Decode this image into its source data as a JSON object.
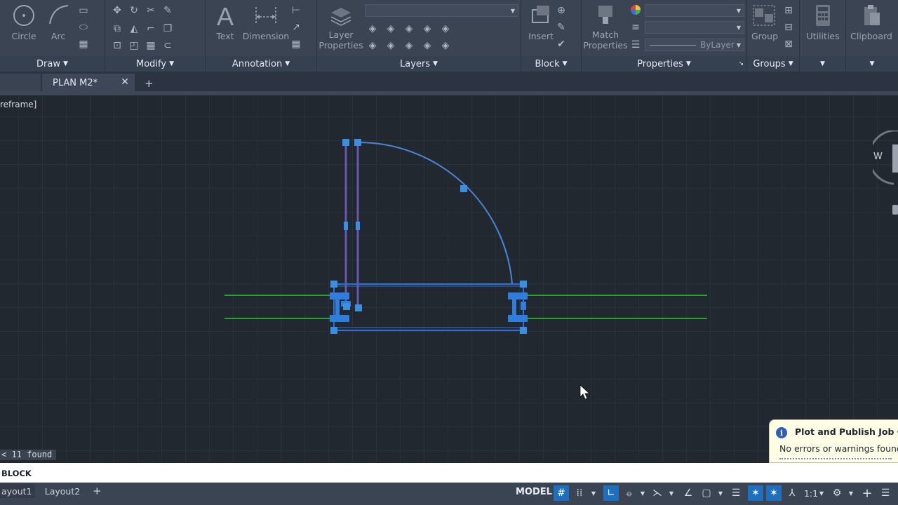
{
  "ribbon": {
    "panels": {
      "draw": "Draw",
      "modify": "Modify",
      "annotation": "Annotation",
      "layers": "Layers",
      "block": "Block",
      "properties": "Properties",
      "groups": "Groups"
    },
    "tools": {
      "circle": "Circle",
      "arc": "Arc",
      "text": "Text",
      "dimension": "Dimension",
      "layer_properties_1": "Layer",
      "layer_properties_2": "Properties",
      "insert": "Insert",
      "match_properties_1": "Match",
      "match_properties_2": "Properties",
      "group": "Group",
      "utilities": "Utilities",
      "clipboard": "Clipboard"
    },
    "lineweight_value": "ByLayer"
  },
  "tabs": {
    "active": "PLAN M2*"
  },
  "viewport": {
    "visual_style_label": "reframe]"
  },
  "viewcube": {
    "west": "W"
  },
  "selection": {
    "found_text": "< 11 found"
  },
  "notification": {
    "title": "Plot and Publish Job Com",
    "body": "No errors or warnings found"
  },
  "command_line": {
    "text": "BLOCK"
  },
  "status": {
    "layout1": "ayout1",
    "layout2": "Layout2",
    "model": "MODEL",
    "scale": "1:1"
  },
  "colors": {
    "accent": "#1e6fbd",
    "grip": "#3a8fe0",
    "selection": "#2f6fd6",
    "wall": "#2ec92e",
    "door": "#7d4aa6"
  }
}
